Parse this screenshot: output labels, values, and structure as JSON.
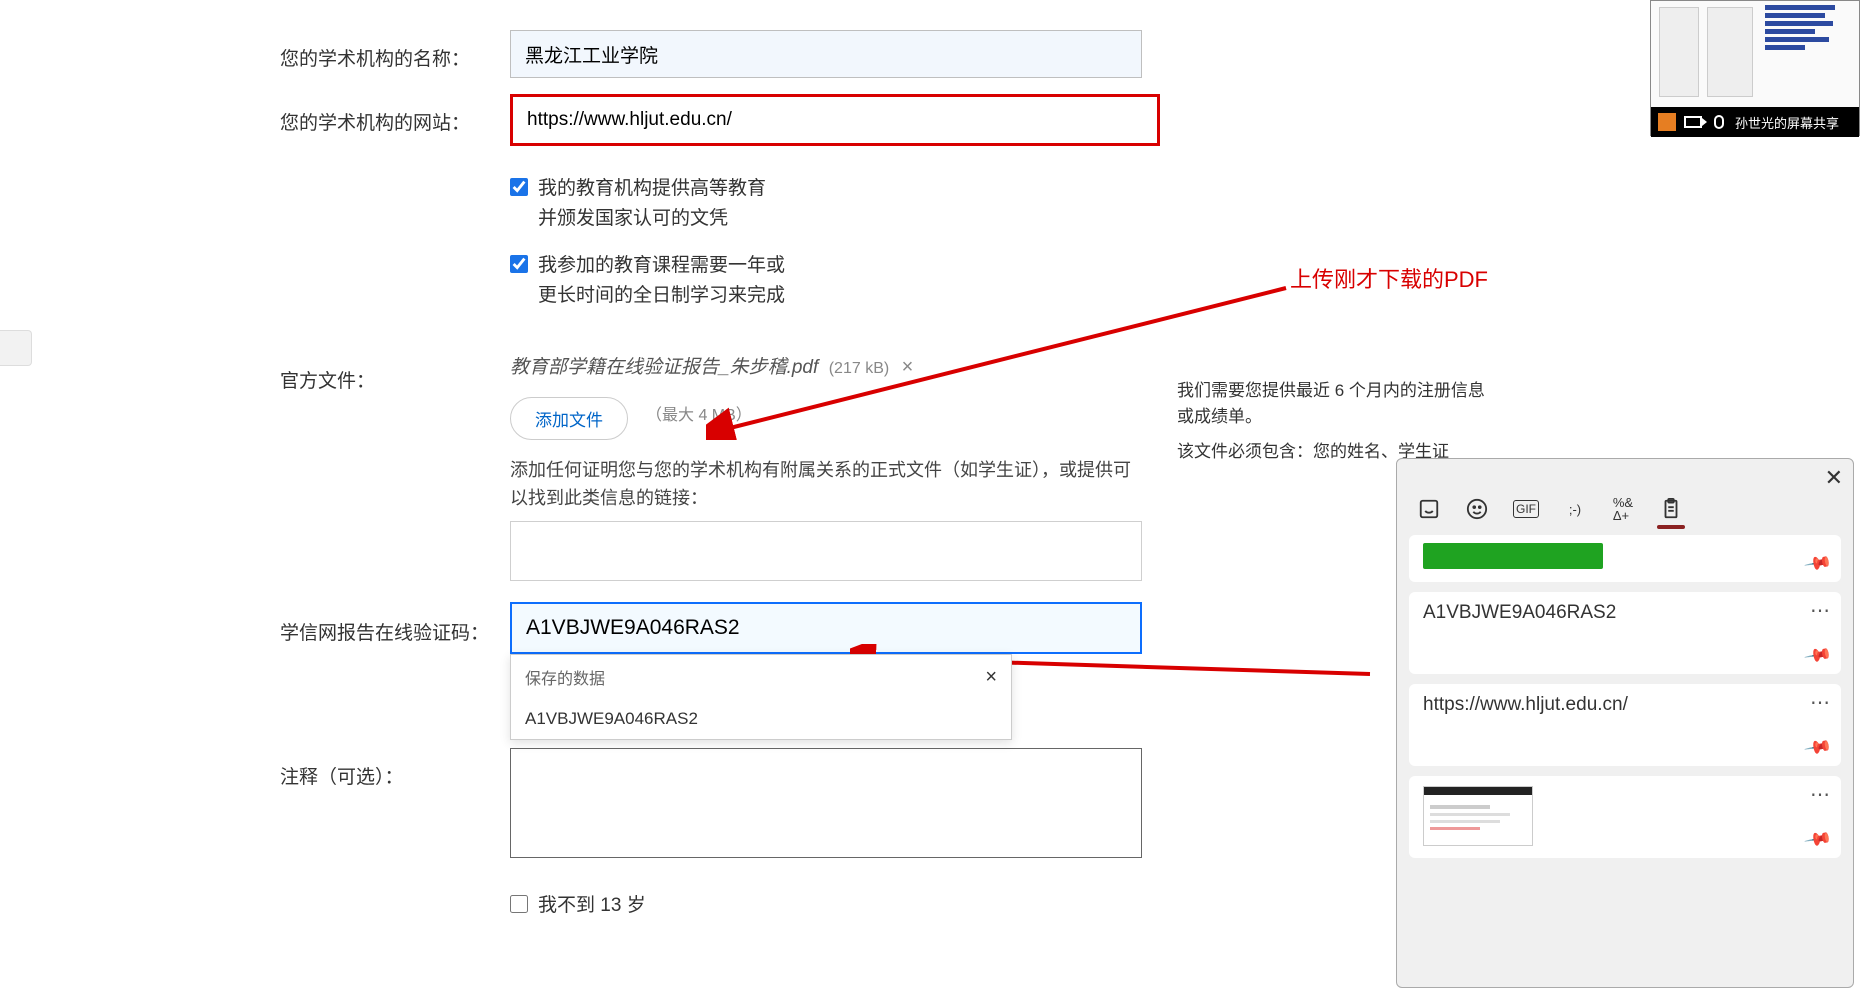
{
  "form": {
    "institution_name": {
      "label": "您的学术机构的名称：",
      "value": "黑龙江工业学院"
    },
    "institution_site": {
      "label": "您的学术机构的网站：",
      "value": "https://www.hljut.edu.cn/"
    },
    "check1": {
      "line1": "我的教育机构提供高等教育",
      "line2": "并颁发国家认可的文凭"
    },
    "check2": {
      "line1": "我参加的教育课程需要一年或",
      "line2": "更长时间的全日制学习来完成"
    },
    "official_doc": {
      "label": "官方文件：",
      "file_name": "教育部学籍在线验证报告_朱步稽.pdf",
      "file_size": "(217 kB)",
      "add_btn": "添加文件",
      "max_hint": "（最大 4 MB）"
    },
    "right_info": {
      "line1": "我们需要您提供最近 6 个月内的注册信息或成绩单。",
      "line2": "该文件必须包含：您的姓名、学生证"
    },
    "extra_files_desc": "添加任何证明您与您的学术机构有附属关系的正式文件（如学生证），或提供可以找到此类信息的链接：",
    "extra_files_value": "",
    "verification_code": {
      "label": "学信网报告在线验证码：",
      "value": "A1VBJWE9A046RAS2"
    },
    "notes": {
      "label": "注释（可选）：",
      "value": ""
    },
    "under13": "我不到 13 岁",
    "autocomplete": {
      "header": "保存的数据",
      "item": "A1VBJWE9A046RAS2"
    }
  },
  "annotation": {
    "upload_pdf": "上传刚才下载的PDF"
  },
  "clipboard": {
    "items": {
      "i1_text": "A1VBJWE9A046RAS2",
      "i2_text": "https://www.hljut.edu.cn/"
    }
  },
  "meeting": {
    "status": "孙世光的屏幕共享"
  }
}
